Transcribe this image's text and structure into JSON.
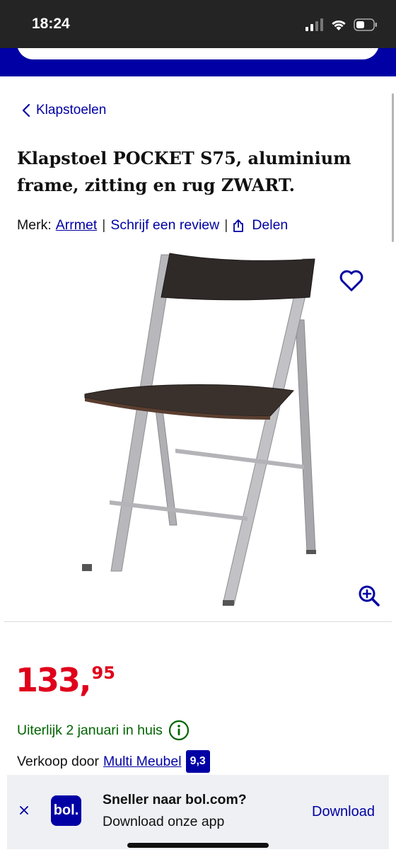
{
  "status_bar": {
    "time": "18:24"
  },
  "breadcrumb": {
    "label": "Klapstoelen"
  },
  "product": {
    "title": "Klapstoel POCKET S75, aluminium frame, zitting en rug ZWART.",
    "brand_label": "Merk:",
    "brand_name": "Arrmet",
    "review_link": "Schrijf een review",
    "share_label": "Delen",
    "price_main": "133,",
    "price_cents": "95",
    "delivery": "Uiterlijk 2 januari in huis",
    "seller_label": "Verkoop door",
    "seller_name": "Multi Meubel",
    "seller_rating": "9,3"
  },
  "app_banner": {
    "logo_text": "bol.",
    "title": "Sneller naar bol.com?",
    "subtitle": "Download onze app",
    "download_label": "Download"
  },
  "colors": {
    "brand_blue": "#0000a4",
    "price_red": "#e0001b",
    "delivery_green": "#006400"
  },
  "icons": {
    "wishlist": "heart-icon",
    "zoom": "zoom-in-icon",
    "share": "share-icon",
    "back": "chevron-left-icon",
    "info": "info-icon",
    "close": "close-icon"
  }
}
